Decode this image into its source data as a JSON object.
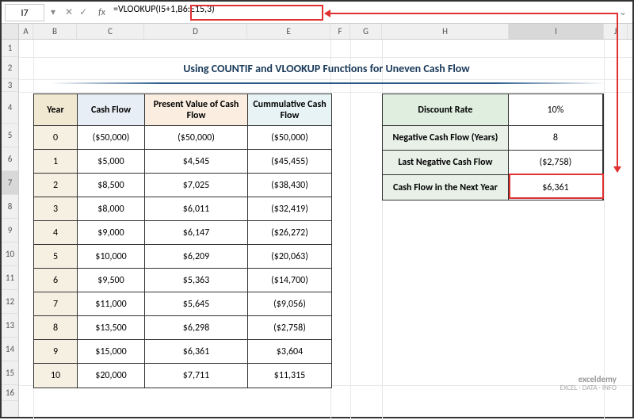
{
  "cell_ref": "I7",
  "formula": "=VLOOKUP(I5+1,B6:E15,3)",
  "title": "Using COUNTIF and VLOOKUP Functions for Uneven Cash Flow",
  "columns": [
    "A",
    "B",
    "C",
    "D",
    "E",
    "F",
    "G",
    "H",
    "I",
    "J"
  ],
  "table": {
    "headers": {
      "year": "Year",
      "cash": "Cash Flow",
      "pv": "Present Value of Cash Flow",
      "cum": "Cummulative Cash Flow"
    },
    "rows": [
      {
        "year": "0",
        "cash": "($50,000)",
        "pv": "($50,000)",
        "cum": "($50,000)"
      },
      {
        "year": "1",
        "cash": "$5,000",
        "pv": "$4,545",
        "cum": "($45,455)"
      },
      {
        "year": "2",
        "cash": "$8,500",
        "pv": "$7,025",
        "cum": "($38,430)"
      },
      {
        "year": "3",
        "cash": "$8,000",
        "pv": "$6,011",
        "cum": "($32,419)"
      },
      {
        "year": "4",
        "cash": "$9,000",
        "pv": "$6,147",
        "cum": "($26,272)"
      },
      {
        "year": "5",
        "cash": "$10,000",
        "pv": "$6,209",
        "cum": "($20,063)"
      },
      {
        "year": "6",
        "cash": "$9,500",
        "pv": "$5,363",
        "cum": "($14,700)"
      },
      {
        "year": "7",
        "cash": "$11,000",
        "pv": "$5,645",
        "cum": "($9,056)"
      },
      {
        "year": "8",
        "cash": "$13,500",
        "pv": "$6,298",
        "cum": "($2,758)"
      },
      {
        "year": "9",
        "cash": "$15,000",
        "pv": "$6,361",
        "cum": "$3,604"
      },
      {
        "year": "10",
        "cash": "$20,000",
        "pv": "$7,711",
        "cum": "$11,315"
      }
    ]
  },
  "side": [
    {
      "label": "Discount Rate",
      "value": "10%"
    },
    {
      "label": "Negative Cash Flow (Years)",
      "value": "8"
    },
    {
      "label": "Last Negative Cash Flow",
      "value": "($2,758)"
    },
    {
      "label": "Cash Flow in the Next Year",
      "value": "$6,361"
    }
  ],
  "watermark": {
    "logo": "exceldemy",
    "tag": "EXCEL · DATA · INFO"
  },
  "icons": {
    "cancel": "✕",
    "confirm": "✓",
    "fx": "fx",
    "dropdown": "▾",
    "expand": "⌄"
  }
}
